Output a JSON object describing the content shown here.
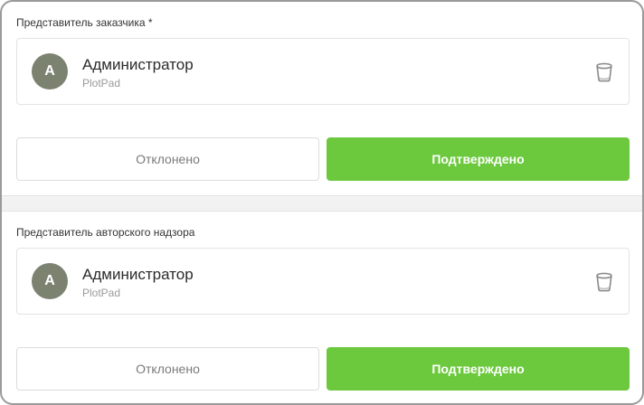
{
  "sections": [
    {
      "label": "Представитель заказчика *",
      "person": {
        "initial": "А",
        "name": "Администратор",
        "org": "PlotPad"
      },
      "reject_label": "Отклонено",
      "confirm_label": "Подтверждено"
    },
    {
      "label": "Представитель авторского надзора",
      "person": {
        "initial": "А",
        "name": "Администратор",
        "org": "PlotPad"
      },
      "reject_label": "Отклонено",
      "confirm_label": "Подтверждено"
    }
  ],
  "icons": {
    "remove": "trash-icon"
  },
  "colors": {
    "confirm": "#6cc93e",
    "avatar": "#7b8270",
    "border": "#e3e3e3"
  }
}
